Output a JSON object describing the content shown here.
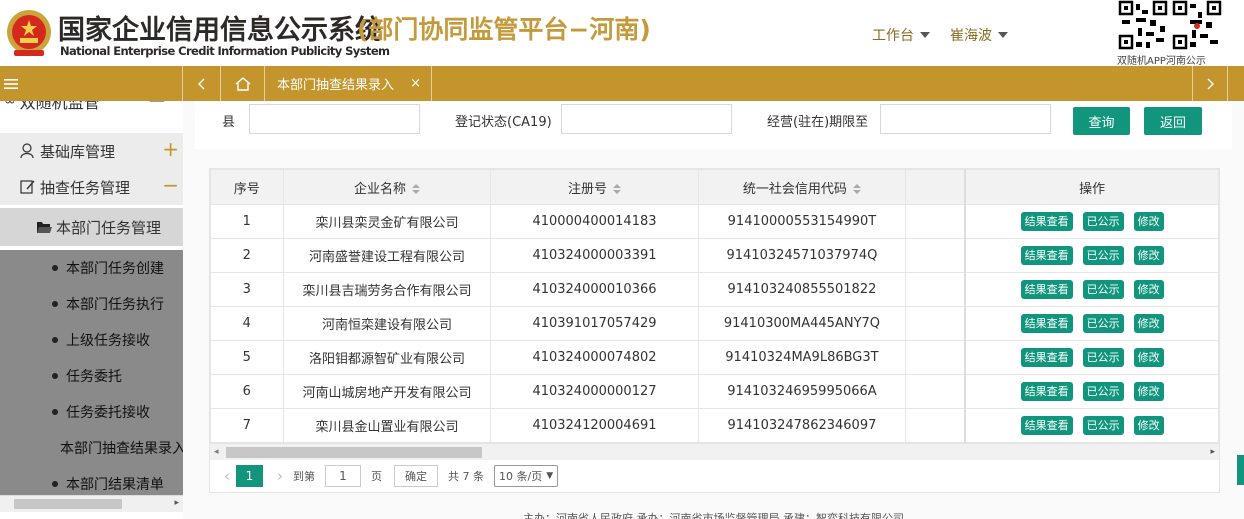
{
  "header": {
    "title_cn": "国家企业信用信息公示系统",
    "title_sub": "(部门协同监管平台−河南)",
    "title_en": "National Enterprise Credit Information Publicity System",
    "menu_workbench": "工作台",
    "menu_user": "崔海波",
    "qr_label": "双随机APP河南公示"
  },
  "topbar": {
    "tab_label": "本部门抽查结果录入",
    "tab_close": "×"
  },
  "sidebar": {
    "partial_item": "双随机监管",
    "items": [
      {
        "label": "基础库管理",
        "icon": "user-icon",
        "toggle": "+"
      },
      {
        "label": "抽查任务管理",
        "icon": "edit-icon",
        "toggle": "−"
      }
    ],
    "sub_group": {
      "label": "本部门任务管理",
      "icon": "folder-open-icon"
    },
    "sub_items": [
      "本部门任务创建",
      "本部门任务执行",
      "上级任务接收",
      "任务委托",
      "任务委托接收",
      "本部门抽查结果录入",
      "本部门结果清单"
    ]
  },
  "search": {
    "county_label": "县",
    "reg_status_label": "登记状态(CA19)",
    "op_period_label": "经营(驻在)期限至",
    "query_button": "查询",
    "back_button": "返回"
  },
  "table": {
    "columns": [
      "序号",
      "企业名称",
      "注册号",
      "统一社会信用代码",
      "",
      "操作"
    ],
    "action_labels": [
      "结果查看",
      "已公示",
      "修改"
    ],
    "rows": [
      {
        "no": "1",
        "name": "栾川县栾灵金矿有限公司",
        "reg": "410000400014183",
        "uscc": "91410000553154990T"
      },
      {
        "no": "2",
        "name": "河南盛誉建设工程有限公司",
        "reg": "410324000003391",
        "uscc": "91410324571037974Q"
      },
      {
        "no": "3",
        "name": "栾川县吉瑞劳务合作有限公司",
        "reg": "410324000010366",
        "uscc": "914103240855501822"
      },
      {
        "no": "4",
        "name": "河南恒栾建设有限公司",
        "reg": "410391017057429",
        "uscc": "91410300MA445ANY7Q"
      },
      {
        "no": "5",
        "name": "洛阳钼都源智矿业有限公司",
        "reg": "410324000074802",
        "uscc": "91410324MA9L86BG3T"
      },
      {
        "no": "6",
        "name": "河南山城房地产开发有限公司",
        "reg": "410324000000127",
        "uscc": "91410324695995066A"
      },
      {
        "no": "7",
        "name": "栾川县金山置业有限公司",
        "reg": "410324120004691",
        "uscc": "914103247862346097"
      }
    ]
  },
  "pager": {
    "current_page": "1",
    "goto_label": "到第",
    "goto_value": "1",
    "page_unit": "页",
    "confirm_button": "确定",
    "total": "共 7 条",
    "page_size": "10 条/页"
  },
  "footer": "主办：河南省人民政府 承办：河南省市场监督管理局 承建：智弈科技有限公司",
  "colors": {
    "gold": "#c4952d",
    "teal": "#11967d"
  }
}
